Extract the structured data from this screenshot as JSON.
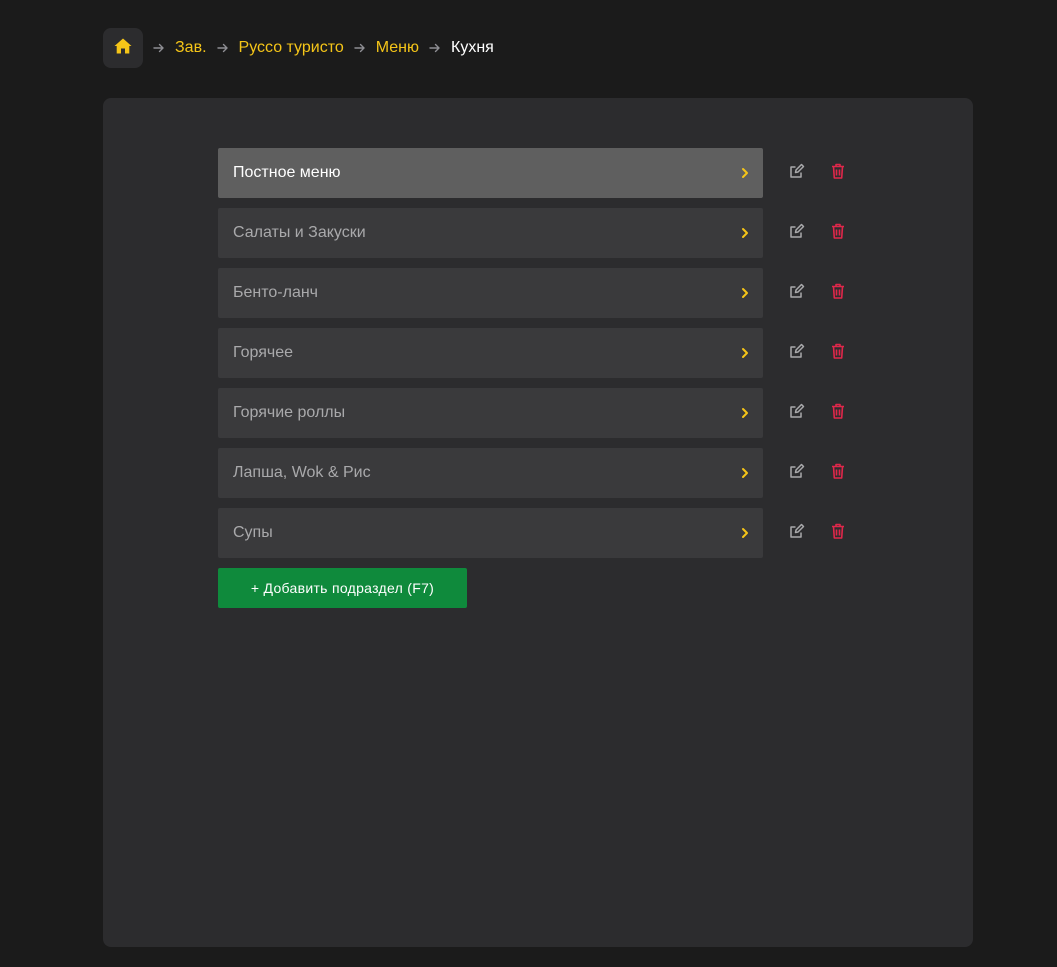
{
  "breadcrumb": {
    "items": [
      "Зав.",
      "Руссо туристо",
      "Меню"
    ],
    "current": "Кухня"
  },
  "sections": [
    {
      "label": "Постное меню",
      "active": true
    },
    {
      "label": "Салаты и Закуски",
      "active": false
    },
    {
      "label": "Бенто-ланч",
      "active": false
    },
    {
      "label": "Горячее",
      "active": false
    },
    {
      "label": "Горячие роллы",
      "active": false
    },
    {
      "label": "Лапша, Wok & Рис",
      "active": false
    },
    {
      "label": "Супы",
      "active": false
    }
  ],
  "add_button": {
    "label": "+ Добавить подраздел (F7)"
  },
  "colors": {
    "accent": "#f5c518",
    "delete": "#e0274a",
    "add": "#0f8a3c"
  },
  "icons": {
    "home": "home-icon",
    "separator": "arrow-right-icon",
    "chevron": "chevron-right-icon",
    "edit": "edit-icon",
    "delete": "trash-icon"
  }
}
